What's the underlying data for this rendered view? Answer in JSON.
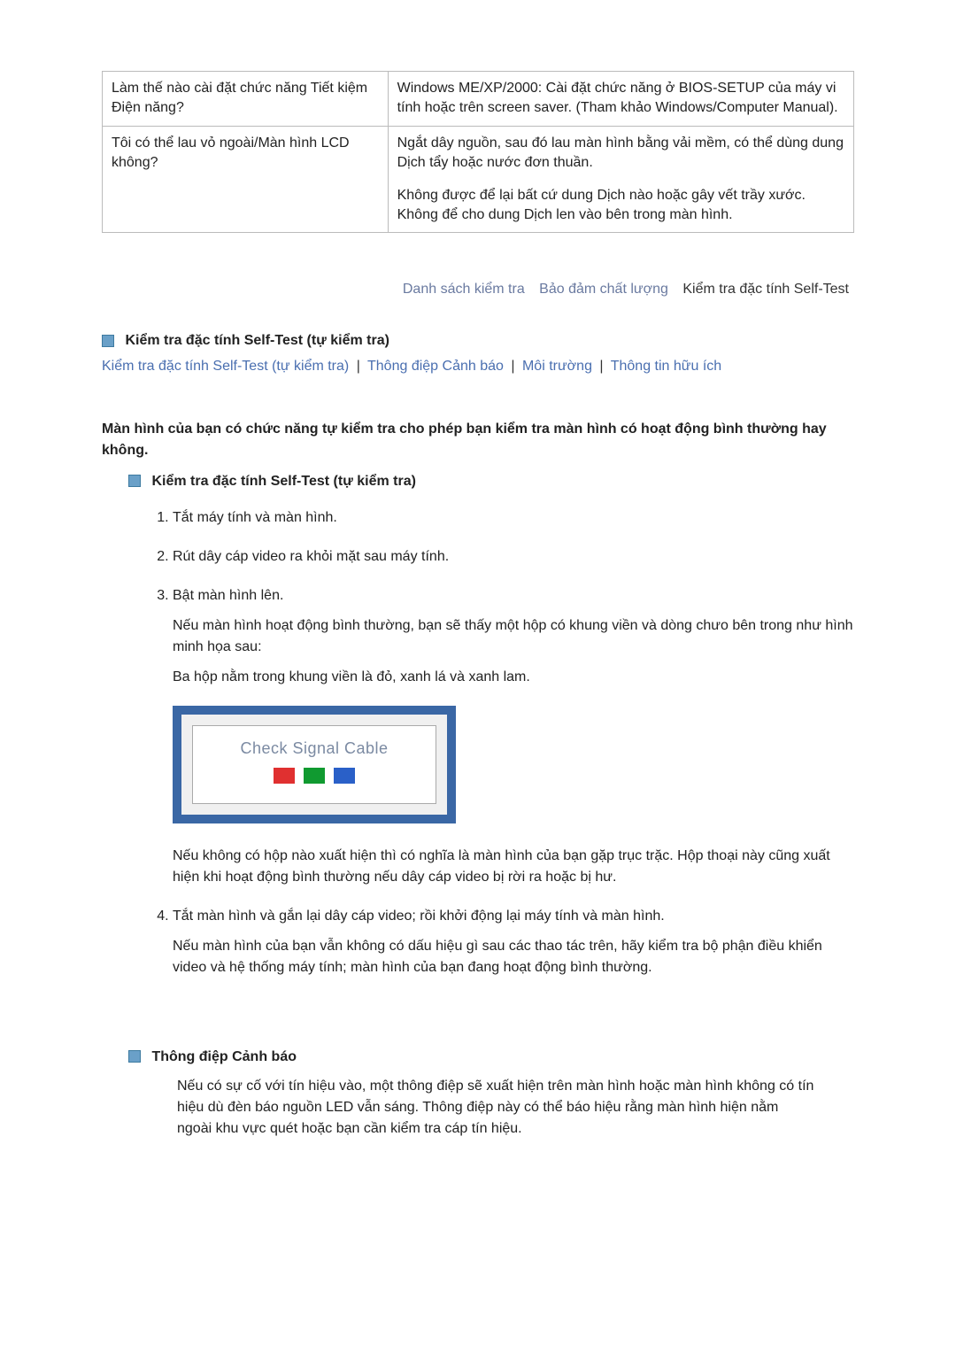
{
  "table": {
    "rows": [
      {
        "q": "Làm thế nào cài đặt chức năng Tiết kiệm Điện năng?",
        "a": [
          "Windows ME/XP/2000: Cài đặt chức năng ở BIOS-SETUP của máy vi tính hoặc trên screen saver. (Tham khảo Windows/Computer Manual)."
        ]
      },
      {
        "q": "Tôi có thể lau vỏ ngoài/Màn hình LCD không?",
        "a": [
          "Ngắt dây nguồn, sau đó lau màn hình bằng vải mềm, có thể dùng dung Dịch tẩy hoặc nước đơn thuần.",
          "Không được để lại bất cứ dung Dịch nào hoặc gây vết trầy xước. Không để cho dung Dịch len vào bên trong màn hình."
        ]
      }
    ]
  },
  "tabs": {
    "t1": "Danh sách kiểm tra",
    "t2": "Bảo đảm chất lượng",
    "t3": "Kiểm tra đặc tính Self-Test"
  },
  "section": {
    "title": "Kiểm tra đặc tính Self-Test (tự kiểm tra)",
    "subnav": {
      "l1": "Kiểm tra đặc tính Self-Test (tự kiểm tra)",
      "l2": "Thông điệp Cảnh báo",
      "l3": "Môi trường",
      "l4": "Thông tin hữu ích"
    },
    "intro": "Màn hình của bạn có chức năng tự kiểm tra cho phép bạn kiểm tra màn hình có hoạt động bình thường hay không.",
    "subhead": "Kiểm tra đặc tính Self-Test (tự kiểm tra)",
    "steps": {
      "s1": "Tắt máy tính và màn hình.",
      "s2": "Rút dây cáp video ra khỏi mặt sau máy tính.",
      "s3": "Bật màn hình lên.",
      "s3_p1": "Nếu màn hình hoạt động bình thường, bạn sẽ thấy một hộp có khung viền và dòng chưo bên trong như hình minh họa sau:",
      "s3_p2": "Ba hộp nằm trong khung viền là đỏ, xanh lá và xanh lam.",
      "s3_p3": "Nếu không có hộp nào xuất hiện thì có nghĩa là màn hình của bạn gặp trục trặc. Hộp thoại này cũng xuất hiện khi hoạt động bình thường nếu dây cáp video bị rời ra hoặc bị hư.",
      "s4": "Tắt màn hình và gắn lại dây cáp video; rồi khởi động lại máy tính và màn hình.",
      "s4_p1": "Nếu màn hình của bạn vẫn không có dấu hiệu gì sau các thao tác trên, hãy kiểm tra bộ phận điều khiển video và hệ thống máy tính; màn hình của bạn đang hoạt động bình thường."
    },
    "signal_label": "Check Signal Cable"
  },
  "warn": {
    "title": "Thông điệp Cảnh báo",
    "body": "Nếu có sự cố với tín hiệu vào, một thông điệp sẽ xuất hiện trên màn hình hoặc màn hình không có tín hiệu dù đèn báo nguồn LED vẫn sáng. Thông điệp này có thể báo hiệu rằng màn hình hiện nằm ngoài khu vực quét hoặc bạn cần kiểm tra cáp tín hiệu."
  }
}
